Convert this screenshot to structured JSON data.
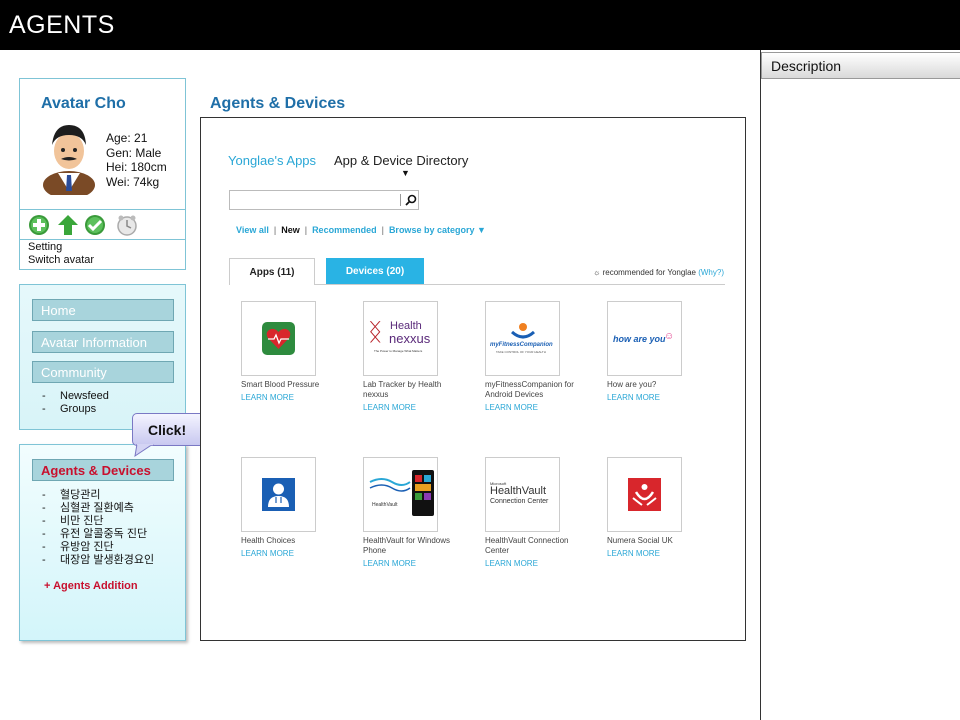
{
  "header": {
    "title": "AGENTS"
  },
  "description_panel": {
    "title": "Description"
  },
  "avatar": {
    "name": "Avatar Cho",
    "age": "Age: 21",
    "gender": "Gen: Male",
    "height": "Hei: 180cm",
    "weight": "Wei: 74kg",
    "setting": "Setting",
    "switch": "Switch avatar",
    "action_icons": [
      "add-icon",
      "upload-icon",
      "check-icon",
      "clock-icon"
    ]
  },
  "nav": {
    "home": "Home",
    "avatar_info": "Avatar Information",
    "community": "Community",
    "community_items": [
      "Newsfeed",
      "Groups"
    ],
    "dash": "-"
  },
  "bubble": {
    "label": "Click!"
  },
  "agents_panel": {
    "title": "Agents & Devices",
    "items": [
      "혈당관리",
      "심혈관 질환예측",
      "비만 진단",
      "유전 알콜중독 진단",
      "유방암 진단",
      "대장암 발생환경요인"
    ],
    "add": "+ Agents Addition"
  },
  "main": {
    "title": "Agents & Devices",
    "store_name": "Yonglae's Apps",
    "directory": "App & Device Directory",
    "caret": "▼",
    "filters": {
      "view_all": "View all",
      "new": "New",
      "recommended": "Recommended",
      "browse": "Browse by category ▼",
      "separator": "|"
    },
    "tabs": {
      "apps": "Apps (11)",
      "devices": "Devices (20)"
    },
    "recommended_note": "recommended for Yonglae",
    "why": "(Why?)",
    "learn_more": "LEARN MORE",
    "apps": [
      {
        "name": "Smart Blood Pressure"
      },
      {
        "name": "Lab Tracker by Health nexxus",
        "logo_a": "Health",
        "logo_b": "nexxus",
        "logo_c": "The Power to Manage What Matters"
      },
      {
        "name": "myFitnessCompanion for Android Devices",
        "logo": "myFitnessCompanion",
        "logo_sub": "TAKE CONTROL OF YOUR HEALTH"
      },
      {
        "name": "How are you?",
        "logo": "how are you"
      },
      {
        "name": "Health Choices"
      },
      {
        "name": "HealthVault for Windows Phone",
        "logo": "HealthVault"
      },
      {
        "name": "HealthVault Connection Center",
        "logo_top": "Microsoft",
        "logo": "HealthVault",
        "logo_sub": "Connection Center"
      },
      {
        "name": "Numera Social UK"
      }
    ]
  },
  "colors": {
    "header_bg": "#000000",
    "accent_blue": "#1f6fa8",
    "link_blue": "#2aa7d6",
    "agents_red": "#c8102e",
    "panel_border": "#7fc4d6"
  }
}
